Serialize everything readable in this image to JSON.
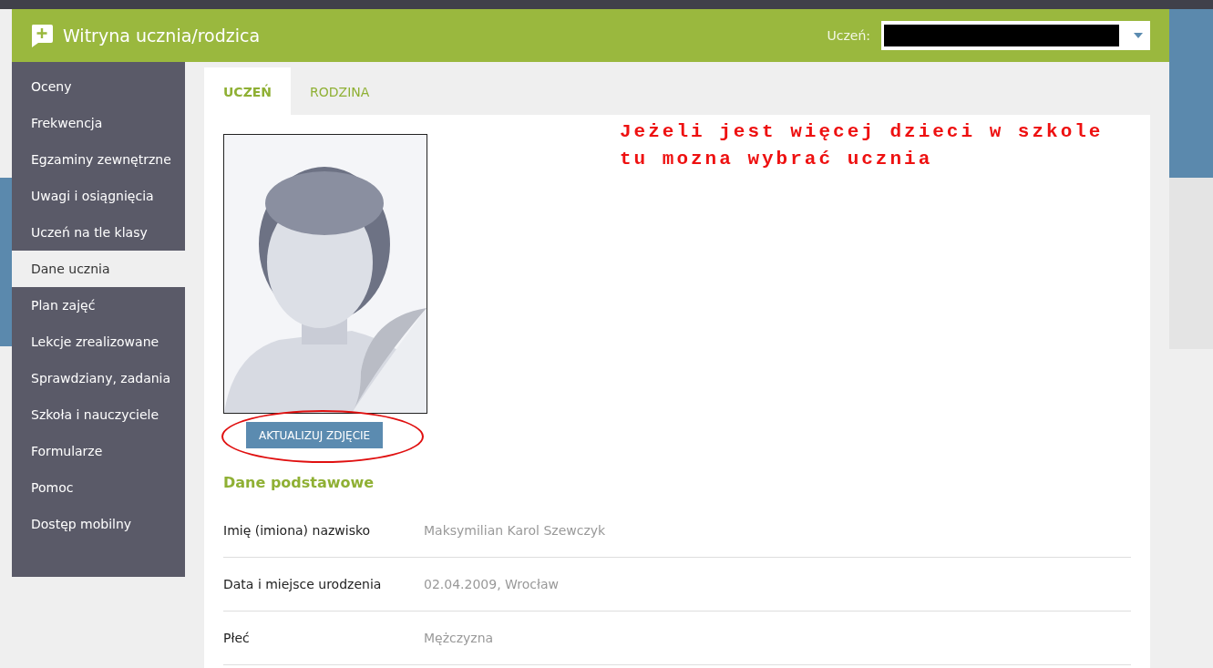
{
  "header": {
    "title": "Witryna ucznia/rodzica",
    "student_label": "Uczeń:"
  },
  "sidebar": {
    "items": [
      {
        "label": "Oceny",
        "selected": false
      },
      {
        "label": "Frekwencja",
        "selected": false
      },
      {
        "label": "Egzaminy zewnętrzne",
        "selected": false
      },
      {
        "label": "Uwagi i osiągnięcia",
        "selected": false
      },
      {
        "label": "Uczeń na tle klasy",
        "selected": false
      },
      {
        "label": "Dane ucznia",
        "selected": true
      },
      {
        "label": "Plan zajęć",
        "selected": false
      },
      {
        "label": "Lekcje zrealizowane",
        "selected": false
      },
      {
        "label": "Sprawdziany, zadania",
        "selected": false
      },
      {
        "label": "Szkoła i nauczyciele",
        "selected": false
      },
      {
        "label": "Formularze",
        "selected": false
      },
      {
        "label": "Pomoc",
        "selected": false
      },
      {
        "label": "Dostęp mobilny",
        "selected": false
      }
    ]
  },
  "tabs": [
    {
      "label": "UCZEŃ",
      "selected": true
    },
    {
      "label": "RODZINA",
      "selected": false
    }
  ],
  "annotation": {
    "lines": [
      "Jeżeli jest więcej dzieci w szkole",
      "tu mozna wybrać ucznia"
    ]
  },
  "photo": {
    "kind": "picture",
    "button": "AKTUALIZUJ ZDJĘCIE"
  },
  "section": {
    "title": "Dane podstawowe",
    "rows": [
      {
        "label": "Imię (imiona) nazwisko",
        "value": "Maksymilian Karol Szewczyk"
      },
      {
        "label": "Data i miejsce urodzenia",
        "value": "02.04.2009, Wrocław"
      },
      {
        "label": "Płeć",
        "value": "Mężczyzna"
      }
    ]
  }
}
